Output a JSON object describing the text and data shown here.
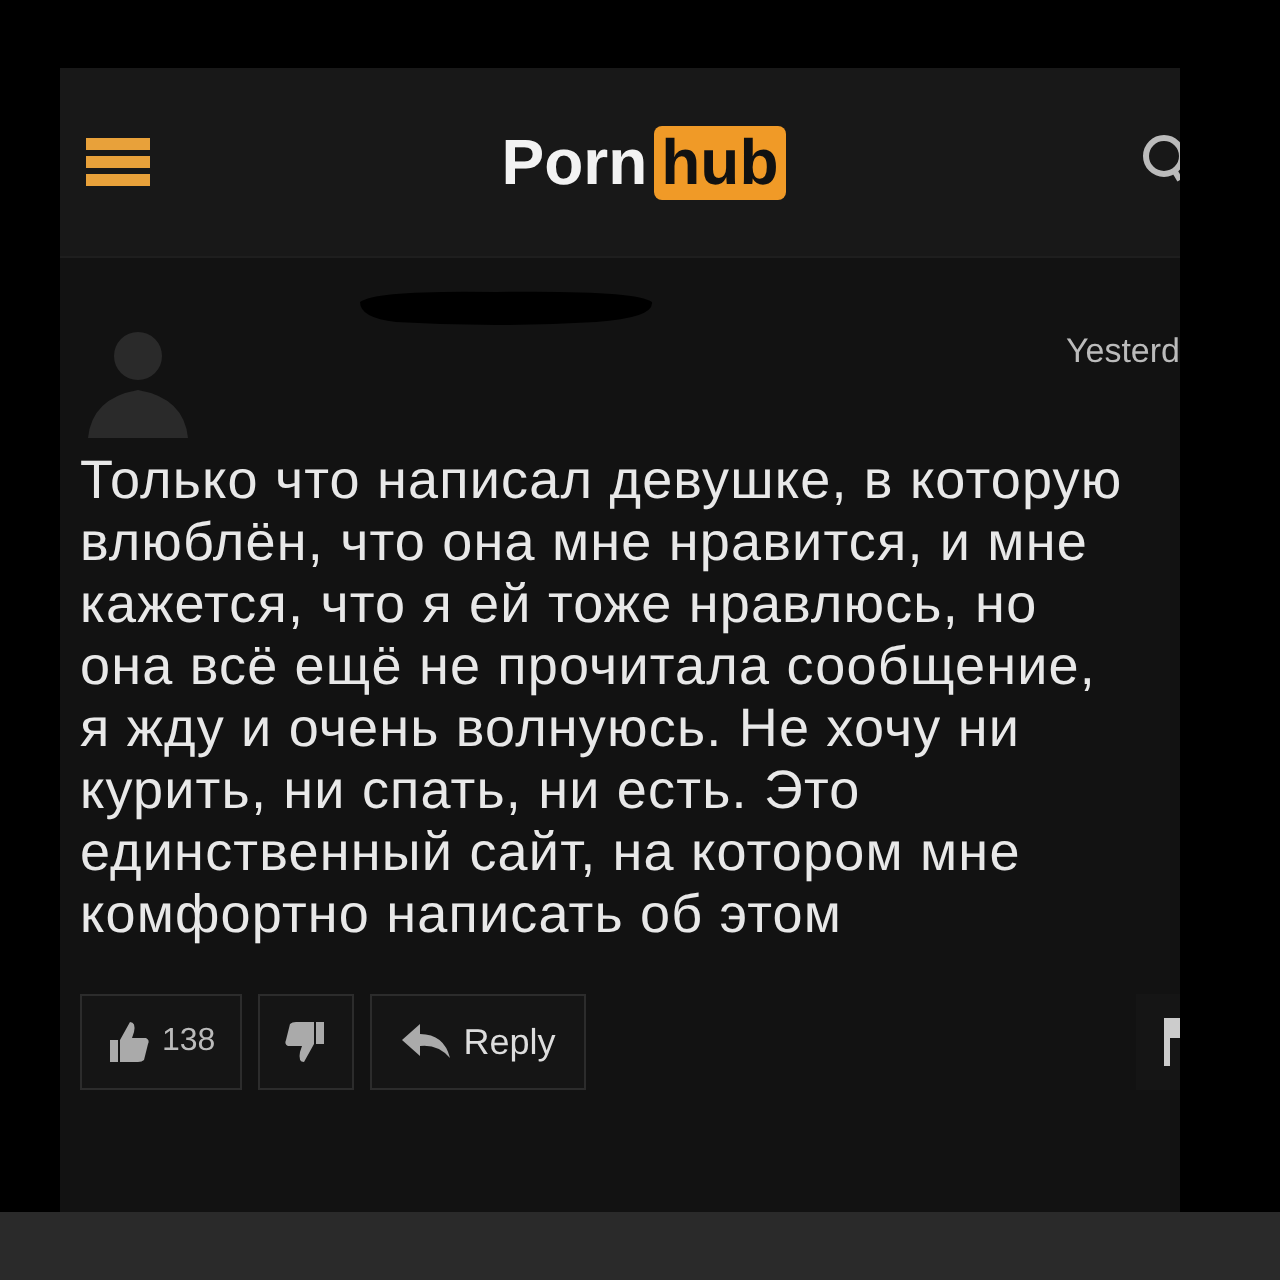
{
  "header": {
    "logo_left": "Porn",
    "logo_right": "hub"
  },
  "comment": {
    "time": "Yesterd",
    "lines": [
      "Только что написал девушке, в которую",
      "влюблён, что она мне нравится, и мне",
      "кажется, что я ей тоже нравлюсь, но",
      "она всё ещё не прочитала сообщение,",
      "я жду и очень волнуюсь. Не хочу ни",
      "курить, ни спать, ни есть. Это",
      "единственный сайт, на котором мне",
      "комфортно написать об этом"
    ],
    "likes": "138",
    "reply": "Reply"
  }
}
